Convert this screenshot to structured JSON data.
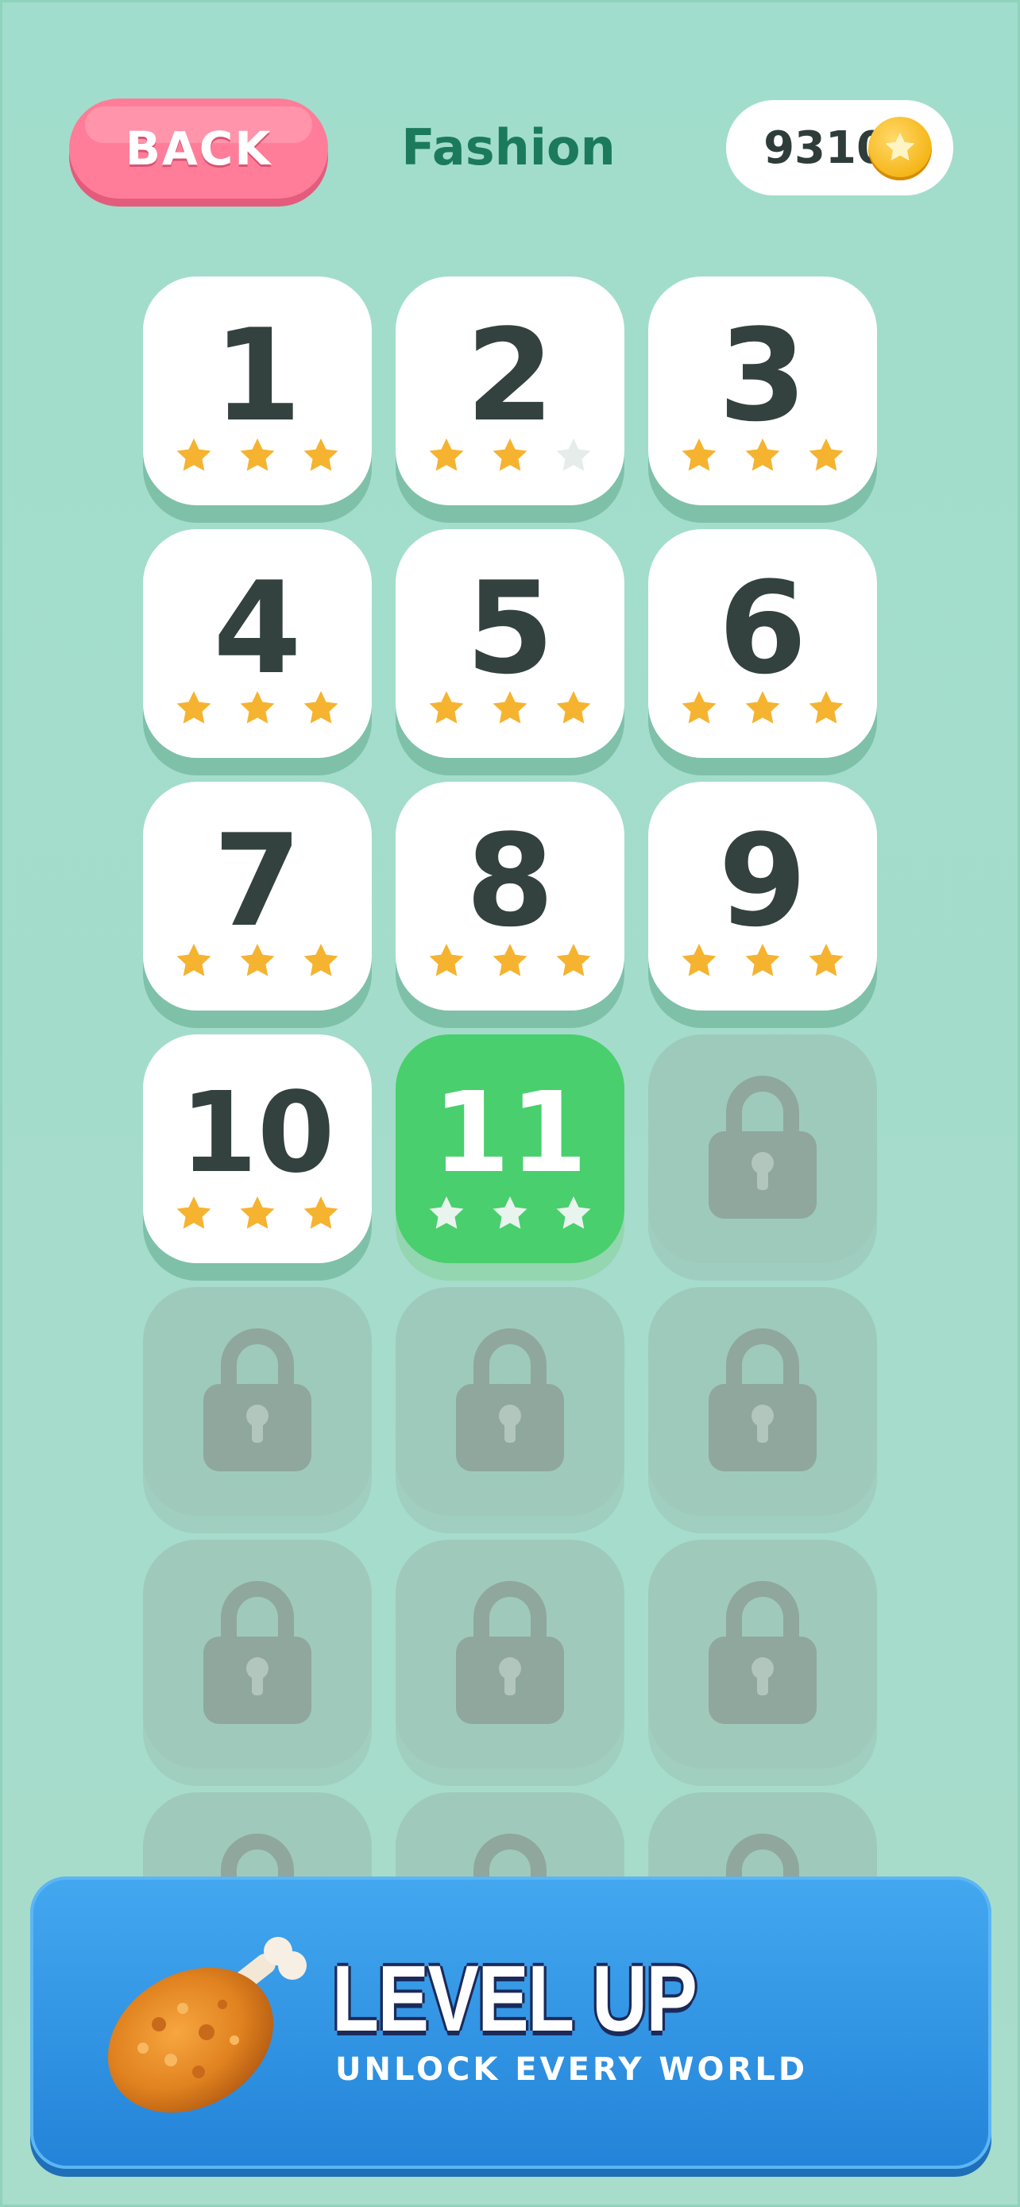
{
  "header": {
    "back_label": "BACK",
    "title": "Fashion",
    "coins": "9310"
  },
  "levels": [
    {
      "label": "1",
      "state": "completed",
      "stars": 3
    },
    {
      "label": "2",
      "state": "completed",
      "stars": 2
    },
    {
      "label": "3",
      "state": "completed",
      "stars": 3
    },
    {
      "label": "4",
      "state": "completed",
      "stars": 3
    },
    {
      "label": "5",
      "state": "completed",
      "stars": 3
    },
    {
      "label": "6",
      "state": "completed",
      "stars": 3
    },
    {
      "label": "7",
      "state": "completed",
      "stars": 3
    },
    {
      "label": "8",
      "state": "completed",
      "stars": 3
    },
    {
      "label": "9",
      "state": "completed",
      "stars": 3
    },
    {
      "label": "10",
      "state": "completed",
      "stars": 3
    },
    {
      "label": "11",
      "state": "current",
      "stars": 0
    },
    {
      "label": "",
      "state": "locked"
    },
    {
      "label": "",
      "state": "locked"
    },
    {
      "label": "",
      "state": "locked"
    },
    {
      "label": "",
      "state": "locked"
    },
    {
      "label": "",
      "state": "locked"
    },
    {
      "label": "",
      "state": "locked"
    },
    {
      "label": "",
      "state": "locked"
    },
    {
      "label": "",
      "state": "locked"
    },
    {
      "label": "",
      "state": "locked"
    },
    {
      "label": "",
      "state": "locked"
    }
  ],
  "banner": {
    "title": "LEVEL UP",
    "subtitle": "UNLOCK EVERY WORLD",
    "icon": "fried-chicken-drumstick-icon"
  },
  "colors": {
    "background": "#a3dccb",
    "back_button": "#ff7d98",
    "title_text": "#1c7a5c",
    "current_level": "#49cf6d",
    "star_filled": "#f5b330",
    "star_empty": "#e6ece9",
    "banner": "#2f92e2"
  }
}
